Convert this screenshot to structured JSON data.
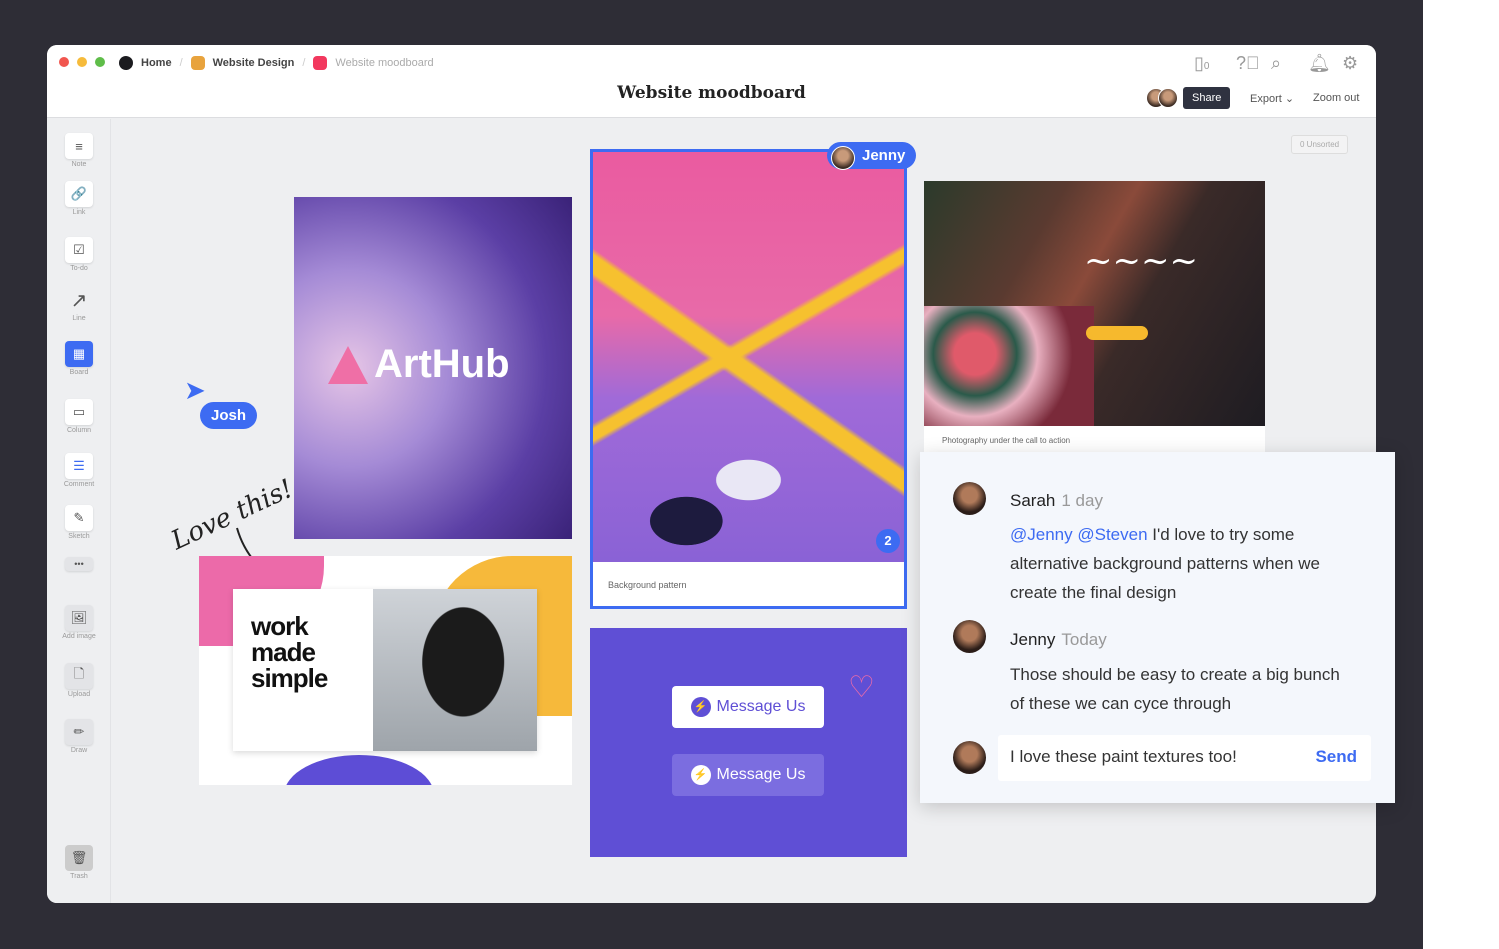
{
  "breadcrumb": {
    "items": [
      {
        "label": "Home",
        "color": "#1b1b1f"
      },
      {
        "label": "Website Design",
        "color": "#e8a33d"
      },
      {
        "label": "Website moodboard",
        "color": "#f2385e"
      }
    ]
  },
  "header": {
    "title": "Website moodboard",
    "device_count": "0",
    "share_label": "Share",
    "export_label": "Export ⌄",
    "zoom_label": "Zoom out"
  },
  "sidebar": {
    "items": [
      {
        "label": "Note",
        "icon": "≡"
      },
      {
        "label": "Link",
        "icon": "🔗"
      },
      {
        "label": "To-do",
        "icon": "☑"
      },
      {
        "label": "Line",
        "icon": "↗"
      },
      {
        "label": "Board",
        "icon": "▦"
      },
      {
        "label": "Column",
        "icon": "▭"
      },
      {
        "label": "Comment",
        "icon": "☰"
      },
      {
        "label": "Sketch",
        "icon": "✎"
      },
      {
        "label": "",
        "icon": "•••"
      },
      {
        "label": "Add image",
        "icon": "🖼"
      },
      {
        "label": "Upload",
        "icon": "🗋"
      },
      {
        "label": "Draw",
        "icon": "✏"
      },
      {
        "label": "Trash",
        "icon": "🗑"
      }
    ]
  },
  "board": {
    "unsorted": "0 Unsorted",
    "arthub_logo": "ArtHub",
    "paint_caption": "Background pattern",
    "comment_count": "2",
    "photo_caption": "Photography under the call to action",
    "work_text": [
      "work",
      "made",
      "simple"
    ],
    "message_us": "Message Us",
    "love_note": "Love this!",
    "cursors": {
      "josh": "Josh",
      "jenny": "Jenny"
    }
  },
  "comments": [
    {
      "author": "Sarah",
      "time": "1 day",
      "mentions": "@Jenny @Steven",
      "text": " I'd love to try some alternative background patterns when we create the final design"
    },
    {
      "author": "Jenny",
      "time": "Today",
      "text": "Those should be easy to create a big bunch of these we can cyce through"
    }
  ],
  "reply": {
    "value": "I love these paint textures too!",
    "send_label": "Send"
  },
  "colors": {
    "accent": "#3d6bf2",
    "purple": "#5f4fd5"
  }
}
